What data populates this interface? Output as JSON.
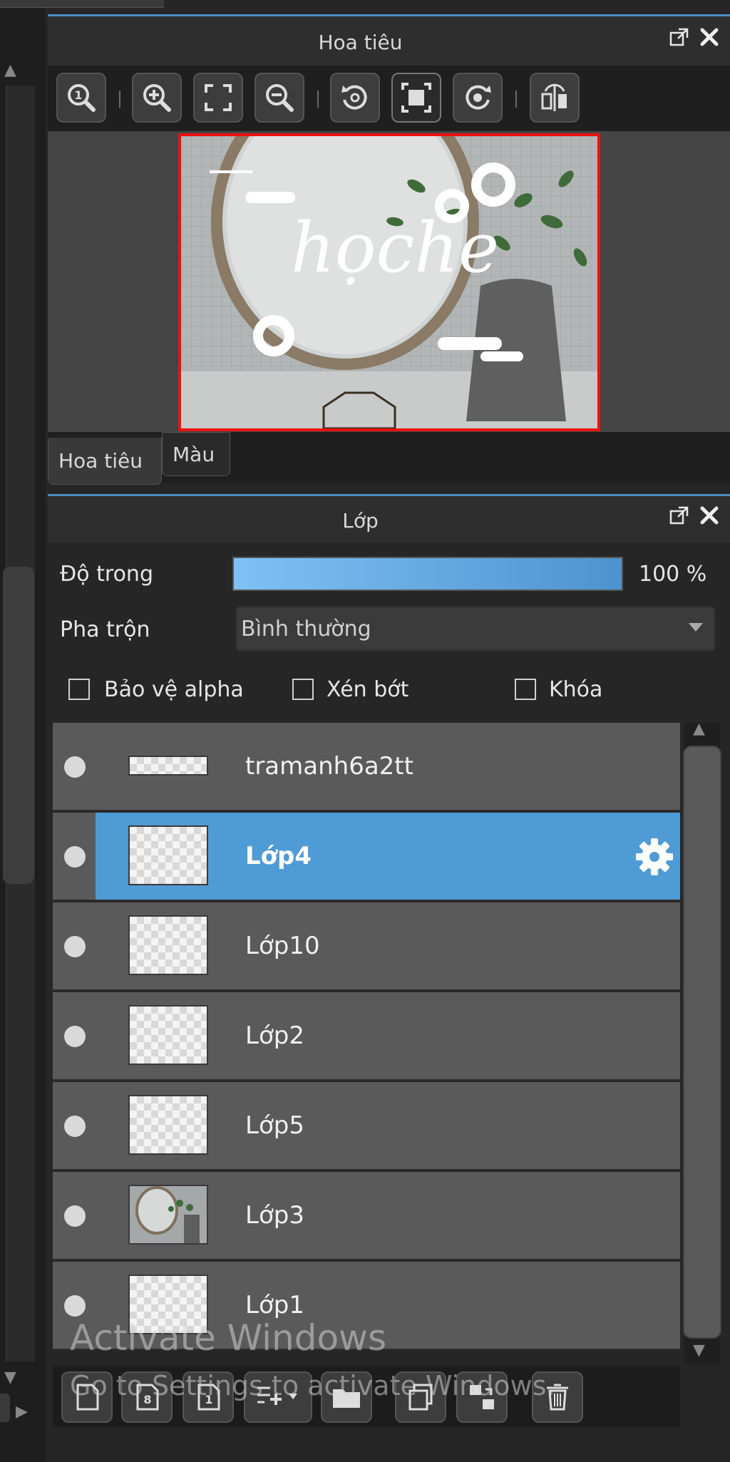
{
  "navigator": {
    "title": "Hoa tiêu",
    "toolbar": [
      "zoom-actual-icon",
      "zoom-in-icon",
      "fit-screen-icon",
      "zoom-out-icon",
      "rotate-left-icon",
      "fit-window-icon",
      "rotate-right-icon",
      "flip-icon"
    ],
    "preview_text": "họche",
    "tabs": [
      "Hoa tiêu",
      "Màu"
    ]
  },
  "layers": {
    "title": "Lớp",
    "opacity_label": "Độ trong",
    "opacity_value": "100 %",
    "opacity_fraction": 1.0,
    "blend_label": "Pha trộn",
    "blend_value": "Bình thường",
    "checkboxes": [
      "Bảo vệ alpha",
      "Xén bớt",
      "Khóa"
    ],
    "items": [
      {
        "name": "tramanh6a2tt"
      },
      {
        "name": "Lớp4",
        "selected": true
      },
      {
        "name": "Lớp10"
      },
      {
        "name": "Lớp2"
      },
      {
        "name": "Lớp5"
      },
      {
        "name": "Lớp3"
      },
      {
        "name": "Lớp1"
      }
    ]
  },
  "watermark": {
    "title": "Activate Windows",
    "subtitle": "Go to Settings to activate Windows."
  },
  "colors": {
    "accent": "#4f9bd5",
    "selection_border": "#e11111",
    "panel_bg": "#262626"
  }
}
